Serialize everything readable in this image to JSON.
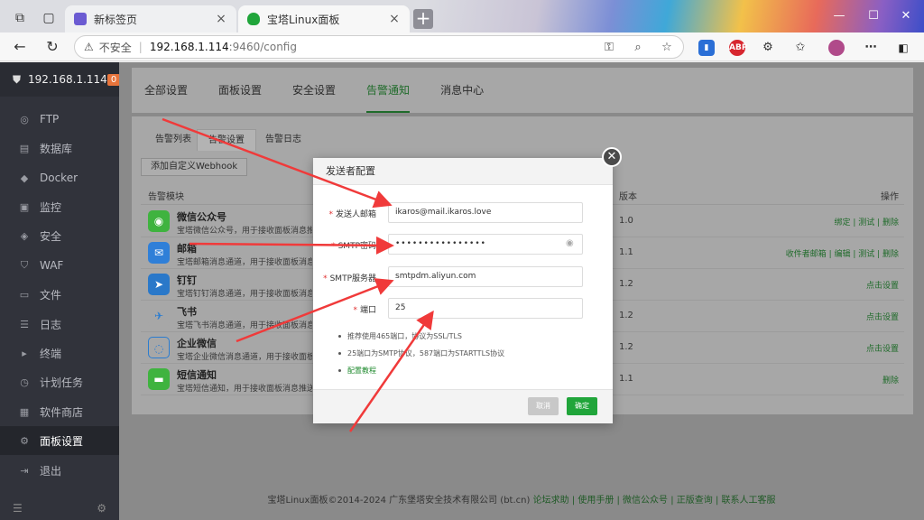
{
  "browser": {
    "tabs": [
      {
        "label": "新标签页"
      },
      {
        "label": "宝塔Linux面板"
      }
    ],
    "address": {
      "insecure_label": "不安全",
      "host": "192.168.1.114",
      "path": ":9460/config"
    },
    "ext_abp": "ABP"
  },
  "sidebar": {
    "server": "192.168.1.114",
    "badge": "0",
    "items": [
      {
        "label": "FTP"
      },
      {
        "label": "数据库"
      },
      {
        "label": "Docker"
      },
      {
        "label": "监控"
      },
      {
        "label": "安全"
      },
      {
        "label": "WAF"
      },
      {
        "label": "文件"
      },
      {
        "label": "日志"
      },
      {
        "label": "终端"
      },
      {
        "label": "计划任务"
      },
      {
        "label": "软件商店"
      },
      {
        "label": "面板设置"
      },
      {
        "label": "退出"
      }
    ]
  },
  "topnav": {
    "items": [
      {
        "label": "全部设置"
      },
      {
        "label": "面板设置"
      },
      {
        "label": "安全设置"
      },
      {
        "label": "告警通知"
      },
      {
        "label": "消息中心"
      }
    ]
  },
  "panel": {
    "subtabs": [
      {
        "label": "告警列表"
      },
      {
        "label": "告警设置"
      },
      {
        "label": "告警日志"
      }
    ],
    "webhook_button": "添加自定义Webhook",
    "columns": {
      "module": "告警模块",
      "version": "版本",
      "action": "操作"
    },
    "rows": [
      {
        "name": "微信公众号",
        "desc": "宝塔微信公众号，用于接收面板消息推送",
        "version": "1.0",
        "action": "绑定 | 测试 | 删除"
      },
      {
        "name": "邮箱",
        "desc": "宝塔邮箱消息通道，用于接收面板消息推送",
        "version": "1.1",
        "action": "收件者邮箱 | 编辑 | 测试 | 删除"
      },
      {
        "name": "钉钉",
        "desc": "宝塔钉钉消息通道，用于接收面板消息推送",
        "version": "1.2",
        "action": "点击设置"
      },
      {
        "name": "飞书",
        "desc": "宝塔飞书消息通道，用于接收面板消息推送",
        "version": "1.2",
        "action": "点击设置"
      },
      {
        "name": "企业微信",
        "desc": "宝塔企业微信消息通道，用于接收面板消息推送",
        "version": "1.2",
        "action": "点击设置"
      },
      {
        "name": "短信通知",
        "desc": "宝塔短信通知，用于接收面板消息推送",
        "version": "1.1",
        "action": "删除"
      }
    ]
  },
  "modal": {
    "title": "发送者配置",
    "fields": {
      "sender_label": "发送人邮箱",
      "sender_value": "ikaros@mail.ikaros.love",
      "password_label": "SMTP密码",
      "password_value": "••••••••••••••••",
      "server_label": "SMTP服务器",
      "server_value": "smtpdm.aliyun.com",
      "port_label": "端口",
      "port_value": "25"
    },
    "tips": [
      "推荐使用465端口，协议为SSL/TLS",
      "25端口为SMTP协议，587端口为STARTTLS协议",
      "配置教程"
    ],
    "cancel": "取消",
    "confirm": "确定"
  },
  "footer": {
    "copyright": "宝塔Linux面板©2014-2024 广东堡塔安全技术有限公司 (bt.cn)",
    "links": "论坛求助 | 使用手册 | 微信公众号 | 正版查询 | 联系人工客服"
  },
  "colors": {
    "accent": "#20a53a",
    "sidebar": "#31333b",
    "arrow": "#f03a3a"
  }
}
